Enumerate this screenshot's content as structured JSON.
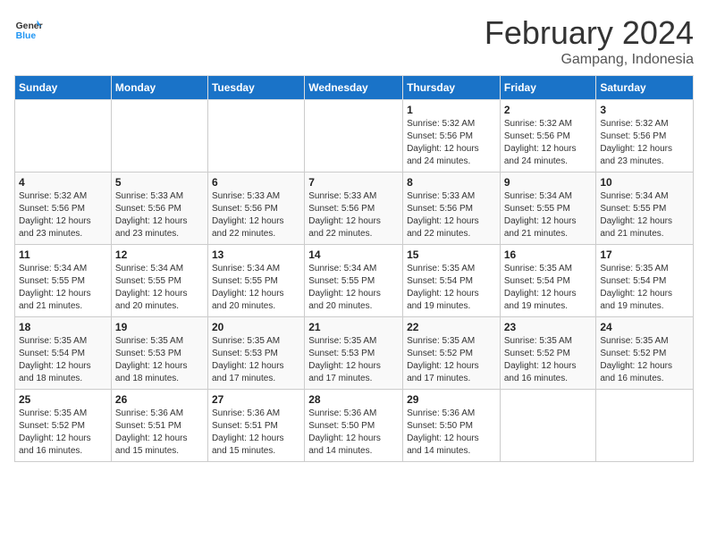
{
  "header": {
    "logo_line1": "General",
    "logo_line2": "Blue",
    "month_year": "February 2024",
    "location": "Gampang, Indonesia"
  },
  "weekdays": [
    "Sunday",
    "Monday",
    "Tuesday",
    "Wednesday",
    "Thursday",
    "Friday",
    "Saturday"
  ],
  "weeks": [
    [
      {
        "day": "",
        "info": ""
      },
      {
        "day": "",
        "info": ""
      },
      {
        "day": "",
        "info": ""
      },
      {
        "day": "",
        "info": ""
      },
      {
        "day": "1",
        "info": "Sunrise: 5:32 AM\nSunset: 5:56 PM\nDaylight: 12 hours\nand 24 minutes."
      },
      {
        "day": "2",
        "info": "Sunrise: 5:32 AM\nSunset: 5:56 PM\nDaylight: 12 hours\nand 24 minutes."
      },
      {
        "day": "3",
        "info": "Sunrise: 5:32 AM\nSunset: 5:56 PM\nDaylight: 12 hours\nand 23 minutes."
      }
    ],
    [
      {
        "day": "4",
        "info": "Sunrise: 5:32 AM\nSunset: 5:56 PM\nDaylight: 12 hours\nand 23 minutes."
      },
      {
        "day": "5",
        "info": "Sunrise: 5:33 AM\nSunset: 5:56 PM\nDaylight: 12 hours\nand 23 minutes."
      },
      {
        "day": "6",
        "info": "Sunrise: 5:33 AM\nSunset: 5:56 PM\nDaylight: 12 hours\nand 22 minutes."
      },
      {
        "day": "7",
        "info": "Sunrise: 5:33 AM\nSunset: 5:56 PM\nDaylight: 12 hours\nand 22 minutes."
      },
      {
        "day": "8",
        "info": "Sunrise: 5:33 AM\nSunset: 5:56 PM\nDaylight: 12 hours\nand 22 minutes."
      },
      {
        "day": "9",
        "info": "Sunrise: 5:34 AM\nSunset: 5:55 PM\nDaylight: 12 hours\nand 21 minutes."
      },
      {
        "day": "10",
        "info": "Sunrise: 5:34 AM\nSunset: 5:55 PM\nDaylight: 12 hours\nand 21 minutes."
      }
    ],
    [
      {
        "day": "11",
        "info": "Sunrise: 5:34 AM\nSunset: 5:55 PM\nDaylight: 12 hours\nand 21 minutes."
      },
      {
        "day": "12",
        "info": "Sunrise: 5:34 AM\nSunset: 5:55 PM\nDaylight: 12 hours\nand 20 minutes."
      },
      {
        "day": "13",
        "info": "Sunrise: 5:34 AM\nSunset: 5:55 PM\nDaylight: 12 hours\nand 20 minutes."
      },
      {
        "day": "14",
        "info": "Sunrise: 5:34 AM\nSunset: 5:55 PM\nDaylight: 12 hours\nand 20 minutes."
      },
      {
        "day": "15",
        "info": "Sunrise: 5:35 AM\nSunset: 5:54 PM\nDaylight: 12 hours\nand 19 minutes."
      },
      {
        "day": "16",
        "info": "Sunrise: 5:35 AM\nSunset: 5:54 PM\nDaylight: 12 hours\nand 19 minutes."
      },
      {
        "day": "17",
        "info": "Sunrise: 5:35 AM\nSunset: 5:54 PM\nDaylight: 12 hours\nand 19 minutes."
      }
    ],
    [
      {
        "day": "18",
        "info": "Sunrise: 5:35 AM\nSunset: 5:54 PM\nDaylight: 12 hours\nand 18 minutes."
      },
      {
        "day": "19",
        "info": "Sunrise: 5:35 AM\nSunset: 5:53 PM\nDaylight: 12 hours\nand 18 minutes."
      },
      {
        "day": "20",
        "info": "Sunrise: 5:35 AM\nSunset: 5:53 PM\nDaylight: 12 hours\nand 17 minutes."
      },
      {
        "day": "21",
        "info": "Sunrise: 5:35 AM\nSunset: 5:53 PM\nDaylight: 12 hours\nand 17 minutes."
      },
      {
        "day": "22",
        "info": "Sunrise: 5:35 AM\nSunset: 5:52 PM\nDaylight: 12 hours\nand 17 minutes."
      },
      {
        "day": "23",
        "info": "Sunrise: 5:35 AM\nSunset: 5:52 PM\nDaylight: 12 hours\nand 16 minutes."
      },
      {
        "day": "24",
        "info": "Sunrise: 5:35 AM\nSunset: 5:52 PM\nDaylight: 12 hours\nand 16 minutes."
      }
    ],
    [
      {
        "day": "25",
        "info": "Sunrise: 5:35 AM\nSunset: 5:52 PM\nDaylight: 12 hours\nand 16 minutes."
      },
      {
        "day": "26",
        "info": "Sunrise: 5:36 AM\nSunset: 5:51 PM\nDaylight: 12 hours\nand 15 minutes."
      },
      {
        "day": "27",
        "info": "Sunrise: 5:36 AM\nSunset: 5:51 PM\nDaylight: 12 hours\nand 15 minutes."
      },
      {
        "day": "28",
        "info": "Sunrise: 5:36 AM\nSunset: 5:50 PM\nDaylight: 12 hours\nand 14 minutes."
      },
      {
        "day": "29",
        "info": "Sunrise: 5:36 AM\nSunset: 5:50 PM\nDaylight: 12 hours\nand 14 minutes."
      },
      {
        "day": "",
        "info": ""
      },
      {
        "day": "",
        "info": ""
      }
    ]
  ]
}
